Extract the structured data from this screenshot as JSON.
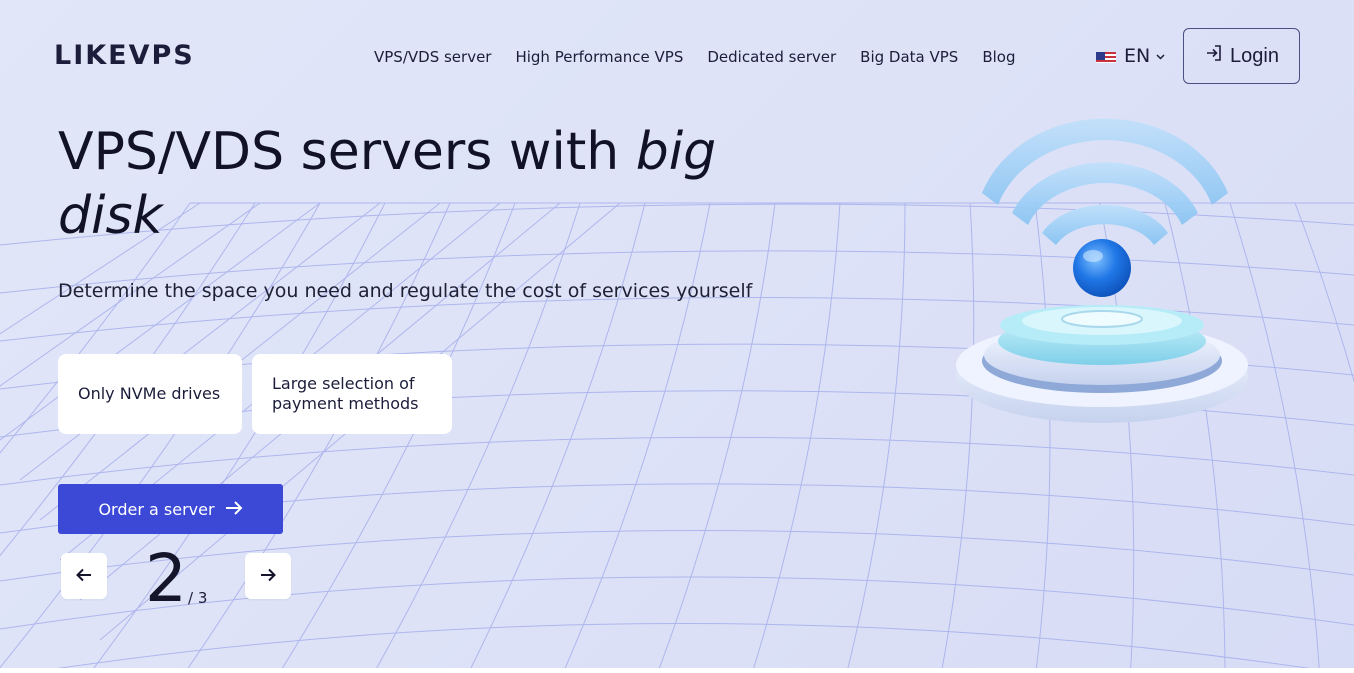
{
  "header": {
    "logo": "LIKEVPS",
    "nav": [
      {
        "label": "VPS/VDS server"
      },
      {
        "label": "High Performance VPS"
      },
      {
        "label": "Dedicated server"
      },
      {
        "label": "Big Data VPS"
      },
      {
        "label": "Blog"
      }
    ],
    "language": {
      "code": "EN",
      "flag_icon": "us-flag-icon"
    },
    "login_label": "Login"
  },
  "hero": {
    "title_plain": "VPS/VDS servers with ",
    "title_em_1": "big",
    "title_em_2": "disk",
    "subtitle": "Determine the space you need and regulate the cost of services yourself",
    "features": [
      {
        "label": "Only NVMe drives"
      },
      {
        "label": "Large selection of payment methods"
      }
    ],
    "order_button": "Order a server"
  },
  "pager": {
    "current": "2",
    "total": "/ 3"
  },
  "colors": {
    "accent": "#3c49d6",
    "background": "#dde2f7",
    "text": "#14152b"
  }
}
